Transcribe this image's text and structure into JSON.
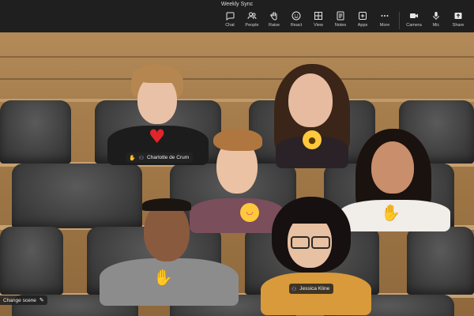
{
  "meeting": {
    "title": "Weekly Sync"
  },
  "toolbar": {
    "items": [
      {
        "label": "Chat",
        "icon": "chat-icon"
      },
      {
        "label": "People",
        "icon": "people-icon"
      },
      {
        "label": "Raise",
        "icon": "raise-hand-icon"
      },
      {
        "label": "React",
        "icon": "react-smiley-icon"
      },
      {
        "label": "View",
        "icon": "view-grid-icon"
      },
      {
        "label": "Notes",
        "icon": "notes-icon"
      },
      {
        "label": "Apps",
        "icon": "apps-plus-icon"
      },
      {
        "label": "More",
        "icon": "more-dots-icon"
      }
    ],
    "media": [
      {
        "label": "Camera",
        "icon": "camera-icon"
      },
      {
        "label": "Mic",
        "icon": "mic-icon"
      },
      {
        "label": "Share",
        "icon": "share-icon"
      }
    ]
  },
  "participants": {
    "charlotte": {
      "name": "Charlotte de Crum",
      "reaction": "heart"
    },
    "top_right": {
      "reaction": "surprised"
    },
    "center": {
      "reaction": "laugh"
    },
    "right": {
      "reaction": "clap"
    },
    "bottom_left": {
      "reaction": "clap"
    },
    "jessica": {
      "name": "Jessica Kline"
    }
  },
  "scene_control": {
    "label": "Change scene",
    "icon": "pencil-icon"
  },
  "colors": {
    "topbar": "#1f1f1f",
    "wood": "#a57c4c",
    "seat": "#3b3b3b",
    "heart": "#e0252b",
    "emoji_yellow": "#ffc83d"
  }
}
